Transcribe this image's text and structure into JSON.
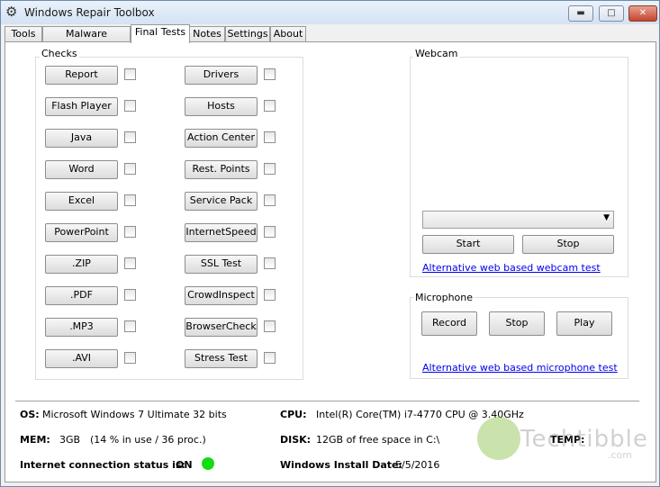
{
  "window": {
    "title": "Windows Repair Toolbox",
    "controls": {
      "minimize": "▬",
      "maximize": "□",
      "close": "✕"
    }
  },
  "tabs": [
    "Tools",
    "Malware Removal",
    "Final Tests",
    "Notes",
    "Settings",
    "About"
  ],
  "active_tab": "Final Tests",
  "checks": {
    "title": "Checks",
    "left": [
      "Report",
      "Flash Player",
      "Java",
      "Word",
      "Excel",
      "PowerPoint",
      ".ZIP",
      ".PDF",
      ".MP3",
      ".AVI"
    ],
    "right": [
      "Drivers",
      "Hosts",
      "Action Center",
      "Rest. Points",
      "Service Pack",
      "InternetSpeed",
      "SSL Test",
      "CrowdInspect",
      "BrowserCheck",
      "Stress Test"
    ]
  },
  "webcam": {
    "title": "Webcam",
    "device_value": "",
    "start": "Start",
    "stop": "Stop",
    "link": "Alternative web based webcam test"
  },
  "microphone": {
    "title": "Microphone",
    "record": "Record",
    "stop": "Stop",
    "play": "Play",
    "link": "Alternative web based microphone test"
  },
  "sysinfo": {
    "os_label": "OS:",
    "os_value": "Microsoft Windows 7 Ultimate  32 bits",
    "mem_label": "MEM:",
    "mem_value": "3GB",
    "mem_usage": "(14 % in use / 36 proc.)",
    "internet_label": "Internet connection status is:",
    "internet_value": "ON",
    "cpu_label": "CPU:",
    "cpu_value": "Intel(R) Core(TM) i7-4770 CPU @ 3.40GHz",
    "disk_label": "DISK:",
    "disk_value": "12GB of free space in C:\\",
    "install_label": "Windows Install Date:",
    "install_value": "5/5/2016",
    "temp_label": "TEMP:"
  },
  "watermark": {
    "brand": "Techtibble",
    "suffix": ".com"
  },
  "colors": {
    "status_on": "#11dd11",
    "link": "#0000ee"
  }
}
